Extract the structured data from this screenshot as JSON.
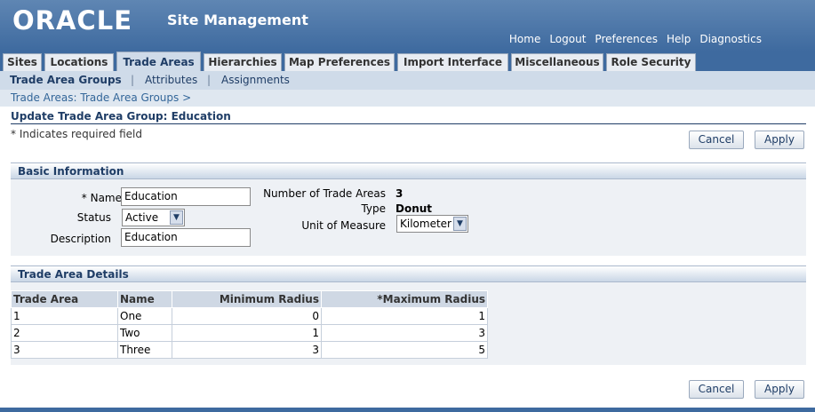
{
  "header": {
    "logo": "ORACLE",
    "app_title": "Site Management",
    "global_links": [
      "Home",
      "Logout",
      "Preferences",
      "Help",
      "Diagnostics"
    ]
  },
  "tabs": [
    {
      "label": "Sites"
    },
    {
      "label": "Locations"
    },
    {
      "label": "Trade Areas"
    },
    {
      "label": "Hierarchies"
    },
    {
      "label": "Map Preferences"
    },
    {
      "label": "Import Interface"
    },
    {
      "label": "Miscellaneous"
    },
    {
      "label": "Role Security"
    }
  ],
  "subtabs": [
    "Trade Area Groups",
    "Attributes",
    "Assignments"
  ],
  "breadcrumb": "Trade Areas: Trade Area Groups  >",
  "page": {
    "title": "Update Trade Area Group: Education",
    "required_note": "* Indicates required field",
    "cancel_label": "Cancel",
    "apply_label": "Apply"
  },
  "basic_info": {
    "header": "Basic Information",
    "name_label": "* Name",
    "name_value": "Education",
    "status_label": "Status",
    "status_value": "Active",
    "description_label": "Description",
    "description_value": "Education",
    "num_trade_areas_label": "Number of Trade Areas",
    "num_trade_areas_value": "3",
    "type_label": "Type",
    "type_value": "Donut",
    "uom_label": "Unit of Measure",
    "uom_value": "Kilometer"
  },
  "details": {
    "header": "Trade Area Details",
    "columns": [
      "Trade Area",
      "Name",
      "Minimum Radius",
      "*Maximum Radius"
    ],
    "rows": [
      [
        "1",
        "One",
        "0",
        "1"
      ],
      [
        "2",
        "Two",
        "1",
        "3"
      ],
      [
        "3",
        "Three",
        "3",
        "5"
      ]
    ]
  },
  "colors": {
    "brand_blue": "#3e6a9f",
    "link_blue": "#336699",
    "title_navy": "#1f3d66"
  },
  "icons": {
    "dropdown": "chevron-down-icon"
  }
}
